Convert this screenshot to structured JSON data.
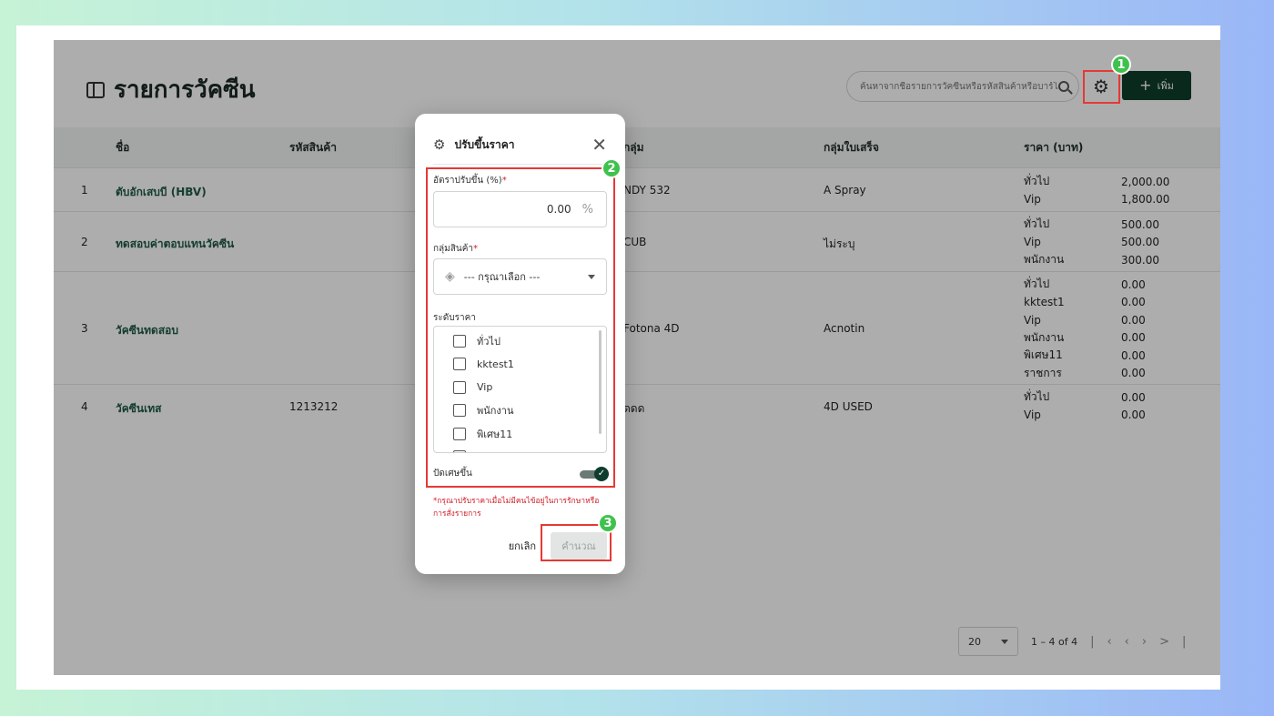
{
  "page": {
    "title": "รายการวัคซีน",
    "search_placeholder": "ค้นหาจากชื่อรายการวัคซีนหรือรหัสสินค้าหรือบาร์โค้ด",
    "add_label": "เพิ่ม"
  },
  "table": {
    "headers": {
      "name": "ชื่อ",
      "code": "รหัสสินค้า",
      "group": "กลุ่ม",
      "receipt_group": "กลุ่มใบเสร็จ",
      "price": "ราคา (บาท)"
    },
    "rows": [
      {
        "no": "1",
        "name": "ตับอักเสบบี (HBV)",
        "code": "",
        "group": "NDY 532",
        "receipt": "A Spray",
        "prices": [
          {
            "level": "ทั่วไป",
            "value": "2,000.00"
          },
          {
            "level": "Vip",
            "value": "1,800.00"
          }
        ]
      },
      {
        "no": "2",
        "name": "ทดสอบค่าตอบแทนวัคซีน",
        "code": "",
        "group": "CUB",
        "receipt": "ไม่ระบุ",
        "prices": [
          {
            "level": "ทั่วไป",
            "value": "500.00"
          },
          {
            "level": "Vip",
            "value": "500.00"
          },
          {
            "level": "พนักงาน",
            "value": "300.00"
          }
        ]
      },
      {
        "no": "3",
        "name": "วัคซีนทดสอบ",
        "code": "",
        "group": "Fotona 4D",
        "receipt": "Acnotin",
        "prices": [
          {
            "level": "ทั่วไป",
            "value": "0.00"
          },
          {
            "level": "kktest1",
            "value": "0.00"
          },
          {
            "level": "Vip",
            "value": "0.00"
          },
          {
            "level": "พนักงาน",
            "value": "0.00"
          },
          {
            "level": "พิเศษ11",
            "value": "0.00"
          },
          {
            "level": "ราชการ",
            "value": "0.00"
          }
        ]
      },
      {
        "no": "4",
        "name": "วัคซีนเทส",
        "code": "1213212",
        "group": "ดดด",
        "receipt": "4D USED",
        "prices": [
          {
            "level": "ทั่วไป",
            "value": "0.00"
          },
          {
            "level": "Vip",
            "value": "0.00"
          }
        ]
      }
    ]
  },
  "pager": {
    "page_size": "20",
    "range": "1 – 4 of 4"
  },
  "modal": {
    "title": "ปรับขึ้นราคา",
    "rate_label": "อัตราปรับขึ้น (%)",
    "rate_value": "0.00",
    "rate_unit": "%",
    "group_label": "กลุ่มสินค้า",
    "group_placeholder": "--- กรุณาเลือก ---",
    "level_label": "ระดับราคา",
    "levels": [
      "ทั่วไป",
      "kktest1",
      "Vip",
      "พนักงาน",
      "พิเศษ11"
    ],
    "round_label": "ปัดเศษขึ้น",
    "round_on": true,
    "warning": "*กรุณาปรับราคาเมื่อไม่มีคนไข้อยู่ในการรักษาหรือการสั่งรายการ",
    "cancel_label": "ยกเลิก",
    "calc_label": "คำนวณ",
    "required_mark": "*"
  },
  "annotations": {
    "badge_1": "1",
    "badge_2": "2",
    "badge_3": "3",
    "highlight_color": "#e53935",
    "badge_color": "#3fc24d"
  },
  "colors": {
    "primary": "#0f3d2b",
    "name_link": "#1f5b44",
    "required": "#d0202a"
  }
}
